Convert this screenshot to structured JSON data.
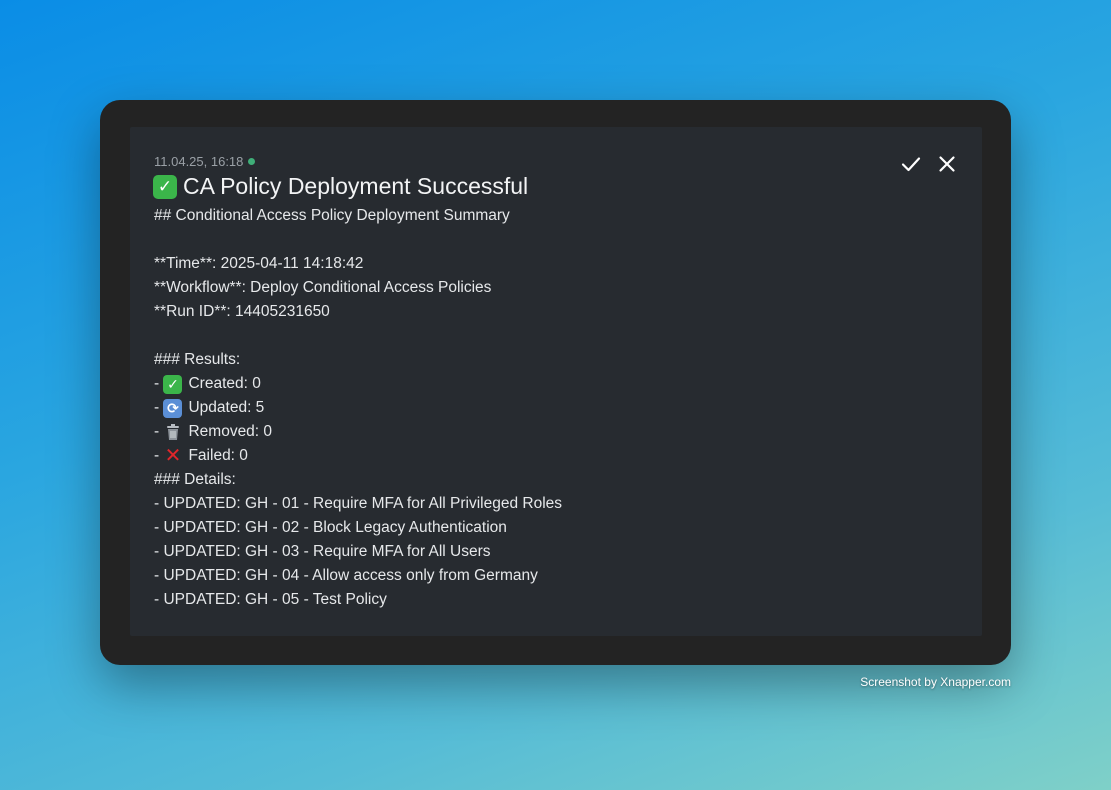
{
  "notification": {
    "timestamp": "11.04.25, 16:18",
    "title_icon": "check-mark-icon",
    "title": "CA Policy Deployment Successful",
    "heading": "## Conditional Access Policy Deployment Summary",
    "time_line": "**Time**: 2025-04-11 14:18:42",
    "workflow_line": "**Workflow**: Deploy Conditional Access Policies",
    "run_id_line": "**Run ID**: 14405231650",
    "results_heading": "### Results:",
    "results": [
      {
        "prefix": "- ",
        "icon": "check-mark-icon",
        "text": "Created: 0"
      },
      {
        "prefix": "- ",
        "icon": "refresh-icon",
        "text": "Updated: 5"
      },
      {
        "prefix": "- ",
        "icon": "trash-icon",
        "text": "Removed: 0"
      },
      {
        "prefix": "- ",
        "icon": "cross-mark-icon",
        "text": "Failed: 0"
      }
    ],
    "details_heading": "### Details:",
    "details": [
      "- UPDATED: GH - 01 - Require MFA for All Privileged Roles",
      "- UPDATED: GH - 02 - Block Legacy Authentication",
      "- UPDATED: GH - 03 - Require MFA for All Users",
      "- UPDATED: GH - 04 - Allow access only from Germany",
      "- UPDATED: GH - 05 - Test Policy"
    ],
    "actions": {
      "confirm_icon": "checkmark-icon",
      "close_icon": "close-icon"
    }
  },
  "watermark": "Screenshot by Xnapper.com",
  "colors": {
    "card_background": "#272b30",
    "frame_background": "#232323",
    "status_dot": "#3fae78"
  }
}
